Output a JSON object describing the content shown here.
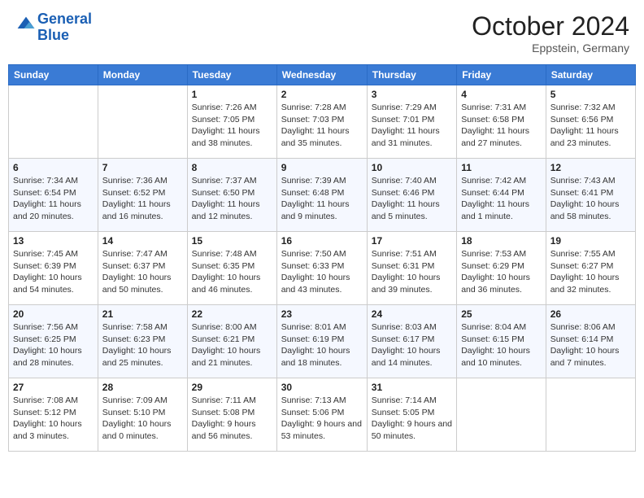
{
  "header": {
    "logo_general": "General",
    "logo_blue": "Blue",
    "month_title": "October 2024",
    "subtitle": "Eppstein, Germany"
  },
  "weekdays": [
    "Sunday",
    "Monday",
    "Tuesday",
    "Wednesday",
    "Thursday",
    "Friday",
    "Saturday"
  ],
  "weeks": [
    [
      {
        "day": "",
        "info": ""
      },
      {
        "day": "",
        "info": ""
      },
      {
        "day": "1",
        "info": "Sunrise: 7:26 AM\nSunset: 7:05 PM\nDaylight: 11 hours and 38 minutes."
      },
      {
        "day": "2",
        "info": "Sunrise: 7:28 AM\nSunset: 7:03 PM\nDaylight: 11 hours and 35 minutes."
      },
      {
        "day": "3",
        "info": "Sunrise: 7:29 AM\nSunset: 7:01 PM\nDaylight: 11 hours and 31 minutes."
      },
      {
        "day": "4",
        "info": "Sunrise: 7:31 AM\nSunset: 6:58 PM\nDaylight: 11 hours and 27 minutes."
      },
      {
        "day": "5",
        "info": "Sunrise: 7:32 AM\nSunset: 6:56 PM\nDaylight: 11 hours and 23 minutes."
      }
    ],
    [
      {
        "day": "6",
        "info": "Sunrise: 7:34 AM\nSunset: 6:54 PM\nDaylight: 11 hours and 20 minutes."
      },
      {
        "day": "7",
        "info": "Sunrise: 7:36 AM\nSunset: 6:52 PM\nDaylight: 11 hours and 16 minutes."
      },
      {
        "day": "8",
        "info": "Sunrise: 7:37 AM\nSunset: 6:50 PM\nDaylight: 11 hours and 12 minutes."
      },
      {
        "day": "9",
        "info": "Sunrise: 7:39 AM\nSunset: 6:48 PM\nDaylight: 11 hours and 9 minutes."
      },
      {
        "day": "10",
        "info": "Sunrise: 7:40 AM\nSunset: 6:46 PM\nDaylight: 11 hours and 5 minutes."
      },
      {
        "day": "11",
        "info": "Sunrise: 7:42 AM\nSunset: 6:44 PM\nDaylight: 11 hours and 1 minute."
      },
      {
        "day": "12",
        "info": "Sunrise: 7:43 AM\nSunset: 6:41 PM\nDaylight: 10 hours and 58 minutes."
      }
    ],
    [
      {
        "day": "13",
        "info": "Sunrise: 7:45 AM\nSunset: 6:39 PM\nDaylight: 10 hours and 54 minutes."
      },
      {
        "day": "14",
        "info": "Sunrise: 7:47 AM\nSunset: 6:37 PM\nDaylight: 10 hours and 50 minutes."
      },
      {
        "day": "15",
        "info": "Sunrise: 7:48 AM\nSunset: 6:35 PM\nDaylight: 10 hours and 46 minutes."
      },
      {
        "day": "16",
        "info": "Sunrise: 7:50 AM\nSunset: 6:33 PM\nDaylight: 10 hours and 43 minutes."
      },
      {
        "day": "17",
        "info": "Sunrise: 7:51 AM\nSunset: 6:31 PM\nDaylight: 10 hours and 39 minutes."
      },
      {
        "day": "18",
        "info": "Sunrise: 7:53 AM\nSunset: 6:29 PM\nDaylight: 10 hours and 36 minutes."
      },
      {
        "day": "19",
        "info": "Sunrise: 7:55 AM\nSunset: 6:27 PM\nDaylight: 10 hours and 32 minutes."
      }
    ],
    [
      {
        "day": "20",
        "info": "Sunrise: 7:56 AM\nSunset: 6:25 PM\nDaylight: 10 hours and 28 minutes."
      },
      {
        "day": "21",
        "info": "Sunrise: 7:58 AM\nSunset: 6:23 PM\nDaylight: 10 hours and 25 minutes."
      },
      {
        "day": "22",
        "info": "Sunrise: 8:00 AM\nSunset: 6:21 PM\nDaylight: 10 hours and 21 minutes."
      },
      {
        "day": "23",
        "info": "Sunrise: 8:01 AM\nSunset: 6:19 PM\nDaylight: 10 hours and 18 minutes."
      },
      {
        "day": "24",
        "info": "Sunrise: 8:03 AM\nSunset: 6:17 PM\nDaylight: 10 hours and 14 minutes."
      },
      {
        "day": "25",
        "info": "Sunrise: 8:04 AM\nSunset: 6:15 PM\nDaylight: 10 hours and 10 minutes."
      },
      {
        "day": "26",
        "info": "Sunrise: 8:06 AM\nSunset: 6:14 PM\nDaylight: 10 hours and 7 minutes."
      }
    ],
    [
      {
        "day": "27",
        "info": "Sunrise: 7:08 AM\nSunset: 5:12 PM\nDaylight: 10 hours and 3 minutes."
      },
      {
        "day": "28",
        "info": "Sunrise: 7:09 AM\nSunset: 5:10 PM\nDaylight: 10 hours and 0 minutes."
      },
      {
        "day": "29",
        "info": "Sunrise: 7:11 AM\nSunset: 5:08 PM\nDaylight: 9 hours and 56 minutes."
      },
      {
        "day": "30",
        "info": "Sunrise: 7:13 AM\nSunset: 5:06 PM\nDaylight: 9 hours and 53 minutes."
      },
      {
        "day": "31",
        "info": "Sunrise: 7:14 AM\nSunset: 5:05 PM\nDaylight: 9 hours and 50 minutes."
      },
      {
        "day": "",
        "info": ""
      },
      {
        "day": "",
        "info": ""
      }
    ]
  ]
}
